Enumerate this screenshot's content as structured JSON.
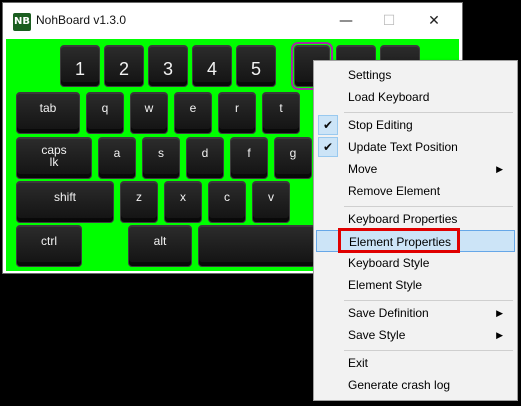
{
  "window": {
    "title": "NohBoard v1.3.0",
    "icon_label": "NB",
    "minimize": "—",
    "maximize": "☐",
    "close": "✕"
  },
  "keyboard": {
    "background": "#00ff00",
    "keys": {
      "k1": "1",
      "k2": "2",
      "k3": "3",
      "k4": "4",
      "k5": "5",
      "tab": "tab",
      "q": "q",
      "w": "w",
      "e": "e",
      "r": "r",
      "t": "t",
      "caps": "caps\nlk",
      "a": "a",
      "s": "s",
      "d": "d",
      "f": "f",
      "g": "g",
      "shift": "shift",
      "z": "z",
      "x": "x",
      "c": "c",
      "v": "v",
      "ctrl": "ctrl",
      "alt": "alt",
      "space": ""
    }
  },
  "context_menu": {
    "items": [
      {
        "label": "Settings"
      },
      {
        "label": "Load Keyboard"
      },
      {
        "label": "Stop Editing",
        "checked": true
      },
      {
        "label": "Update Text Position",
        "checked": true
      },
      {
        "label": "Move",
        "submenu": true
      },
      {
        "label": "Remove Element"
      },
      {
        "label": "Keyboard Properties"
      },
      {
        "label": "Element Properties",
        "highlighted": true
      },
      {
        "label": "Keyboard Style"
      },
      {
        "label": "Element Style"
      },
      {
        "label": "Save Definition",
        "submenu": true
      },
      {
        "label": "Save Style",
        "submenu": true
      },
      {
        "label": "Exit"
      },
      {
        "label": "Generate crash log"
      }
    ],
    "check_glyph": "✔",
    "arrow_glyph": "▶"
  }
}
